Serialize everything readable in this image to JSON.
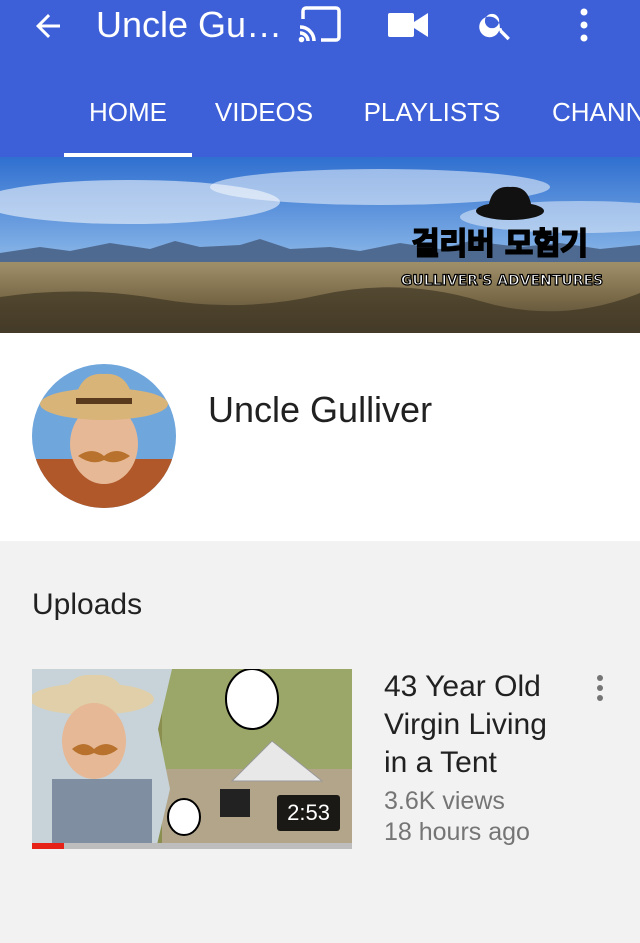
{
  "header": {
    "title": "Uncle Gulliver",
    "bg_color": "#3d5fd8",
    "icons": [
      "back-arrow-icon",
      "cast-icon",
      "video-camera-icon",
      "search-icon",
      "more-vert-icon"
    ]
  },
  "tabs": [
    {
      "label": "HOME",
      "active": true
    },
    {
      "label": "VIDEOS",
      "active": false
    },
    {
      "label": "PLAYLISTS",
      "active": false
    },
    {
      "label": "CHANNELS",
      "active": false
    }
  ],
  "banner": {
    "logo_korean": "걸리버 모험기",
    "logo_english": "GULLIVER'S ADVENTURES"
  },
  "channel": {
    "name": "Uncle Gulliver"
  },
  "uploads": {
    "heading": "Uploads",
    "videos": [
      {
        "title": "43 Year Old Virgin Living in a Tent",
        "duration": "2:53",
        "views": "3.6K views",
        "age": "18 hours ago",
        "watched_fraction": 0.1
      }
    ]
  }
}
